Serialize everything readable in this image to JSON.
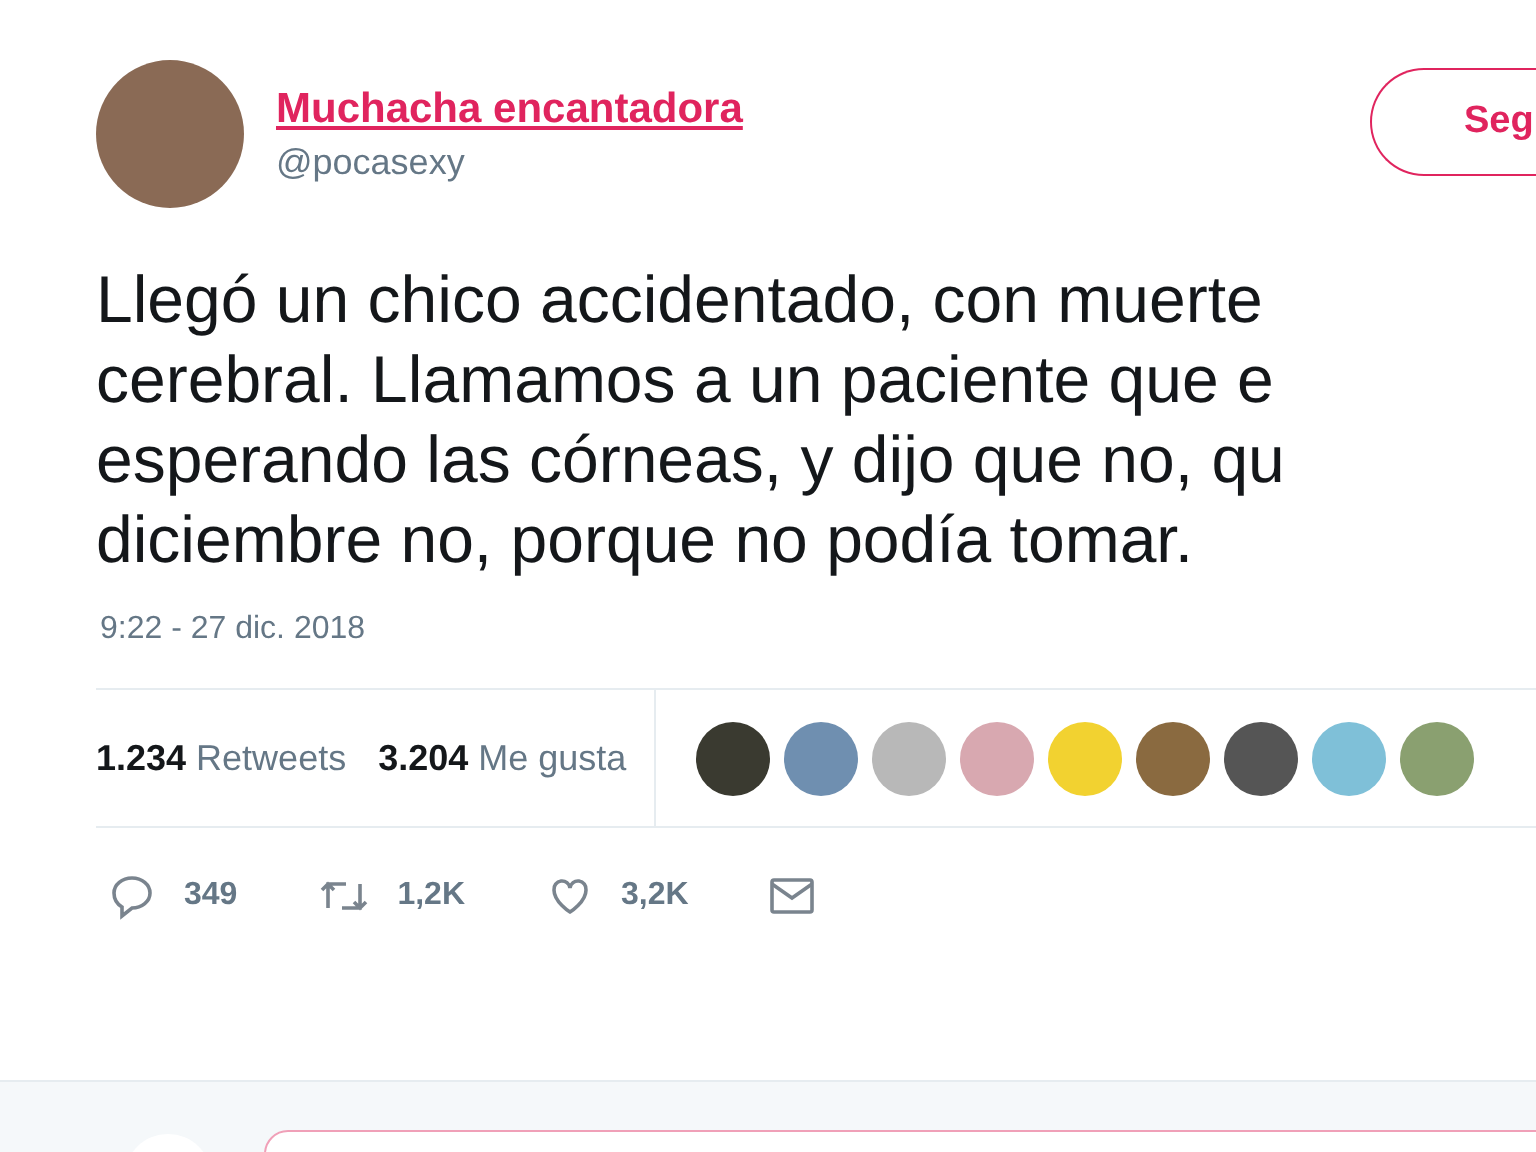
{
  "author": {
    "name": "Muchacha encantadora",
    "handle": "@pocasexy"
  },
  "follow_button": {
    "label": "Seg"
  },
  "tweet_lines": [
    "Llegó un chico accidentado, con muerte",
    "cerebral. Llamamos a un paciente que e",
    "esperando las córneas, y dijo que no, qu",
    "diciembre no, porque no podía tomar."
  ],
  "timestamp": "9:22 - 27 dic. 2018",
  "stats": [
    {
      "count": "1.234",
      "label": "Retweets"
    },
    {
      "count": "3.204",
      "label": "Me gusta"
    }
  ],
  "likers": [
    {
      "color": "#3a3a30"
    },
    {
      "color": "#6f8fb0"
    },
    {
      "color": "#b8b8b8"
    },
    {
      "color": "#d8a8b0"
    },
    {
      "color": "#f2d230"
    },
    {
      "color": "#8a6a40"
    },
    {
      "color": "#555555"
    },
    {
      "color": "#7fc0d8"
    },
    {
      "color": "#8aa070"
    }
  ],
  "actions": [
    {
      "kind": "reply",
      "count": "349"
    },
    {
      "kind": "retweet",
      "count": "1,2K"
    },
    {
      "kind": "like",
      "count": "3,2K"
    },
    {
      "kind": "message"
    }
  ]
}
